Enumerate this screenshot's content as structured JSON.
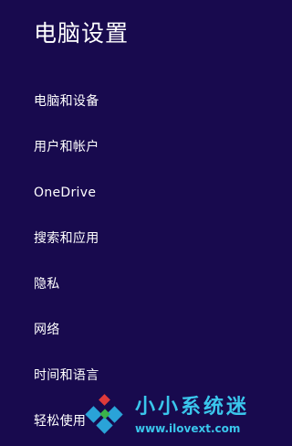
{
  "header": {
    "title": "电脑设置"
  },
  "nav": {
    "items": [
      {
        "label": "电脑和设备"
      },
      {
        "label": "用户和帐户"
      },
      {
        "label": "OneDrive"
      },
      {
        "label": "搜索和应用"
      },
      {
        "label": "隐私"
      },
      {
        "label": "网络"
      },
      {
        "label": "时间和语言"
      },
      {
        "label": "轻松使用"
      }
    ]
  },
  "watermark": {
    "title": "小小系统迷",
    "url": "www.ilovext.com",
    "colors": {
      "text": "#3ac6ec",
      "logo_blue": "#2aa3d8",
      "logo_red": "#e03a3a",
      "logo_green": "#3bb34a"
    }
  },
  "colors": {
    "background": "#180a4e",
    "text": "#ffffff"
  }
}
